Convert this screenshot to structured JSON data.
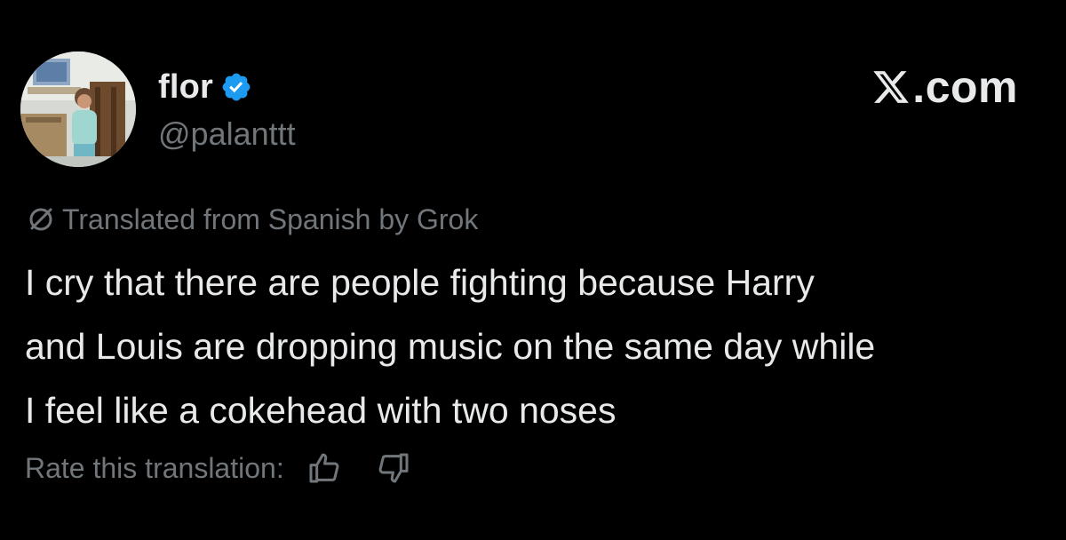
{
  "author": {
    "display_name": "flor",
    "handle": "@palanttt",
    "verified": true,
    "verified_color": "#1d9bf0"
  },
  "brand": {
    "text": ".com",
    "icon": "x-logo-icon"
  },
  "translation": {
    "note": "Translated from Spanish by Grok",
    "icon": "translate-icon"
  },
  "tweet": {
    "lines": [
      "I cry that there are people fighting because Harry",
      "and Louis are dropping music on the same day while",
      "I feel like a cokehead with two noses"
    ]
  },
  "rating": {
    "label": "Rate this translation:",
    "thumbs_up_icon": "thumbs-up-icon",
    "thumbs_down_icon": "thumbs-down-icon"
  },
  "colors": {
    "background": "#000000",
    "primary_text": "#e7e9ea",
    "secondary_text": "#71767b"
  }
}
